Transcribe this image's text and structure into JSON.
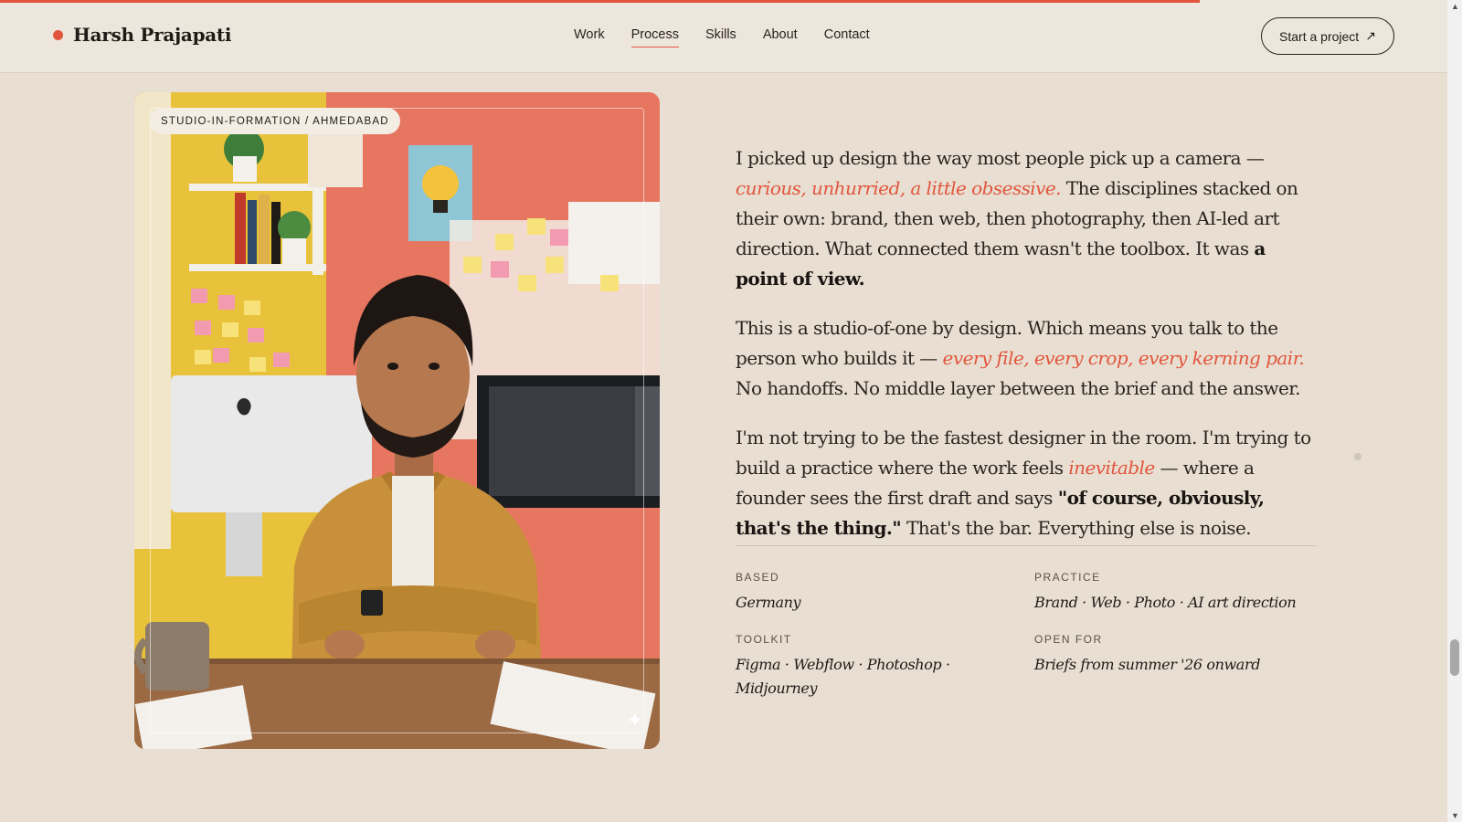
{
  "header": {
    "brand_name": "Harsh Prajapati",
    "nav": [
      {
        "label": "Work",
        "active": false
      },
      {
        "label": "Process",
        "active": true
      },
      {
        "label": "Skills",
        "active": false
      },
      {
        "label": "About",
        "active": false
      },
      {
        "label": "Contact",
        "active": false
      }
    ],
    "cta_label": "Start a project",
    "cta_icon": "arrow-up-right-icon"
  },
  "scroll_progress": 0.82,
  "photo": {
    "tag": "STUDIO-IN-FORMATION / AHMEDABAD",
    "description_icon": "portrait-photo"
  },
  "about": {
    "p1": {
      "a": "I picked up design the way most people pick up a camera — ",
      "em": "curious, unhurried, a little obsessive.",
      "b": " The disciplines stacked on their own: brand, then web, then photography, then AI-led art direction. What connected them wasn't the toolbox. It was ",
      "strong": "a point of view."
    },
    "p2": {
      "a": "This is a studio-of-one by design. Which means you talk to the person who builds it — ",
      "em": "every file, every crop, every kerning pair.",
      "b": " No handoffs. No middle layer between the brief and the answer."
    },
    "p3": {
      "a": "I'm not trying to be the fastest designer in the room. I'm trying to build a practice where the work feels ",
      "em": "inevitable",
      "b": " — where a founder sees the first draft and says ",
      "strong": "\"of course, obviously, that's the thing.\"",
      "c": " That's the bar. Everything else is noise."
    }
  },
  "meta": [
    {
      "label": "BASED",
      "value": "Germany"
    },
    {
      "label": "PRACTICE",
      "value": "Brand · Web · Photo · AI art direction"
    },
    {
      "label": "TOOLKIT",
      "value": "Figma · Webflow · Photoshop · Midjourney"
    },
    {
      "label": "OPEN FOR",
      "value": "Briefs from summer '26 onward"
    }
  ],
  "colors": {
    "accent": "#e2553c",
    "background": "#e8dfd2",
    "header": "#ede6dc"
  }
}
